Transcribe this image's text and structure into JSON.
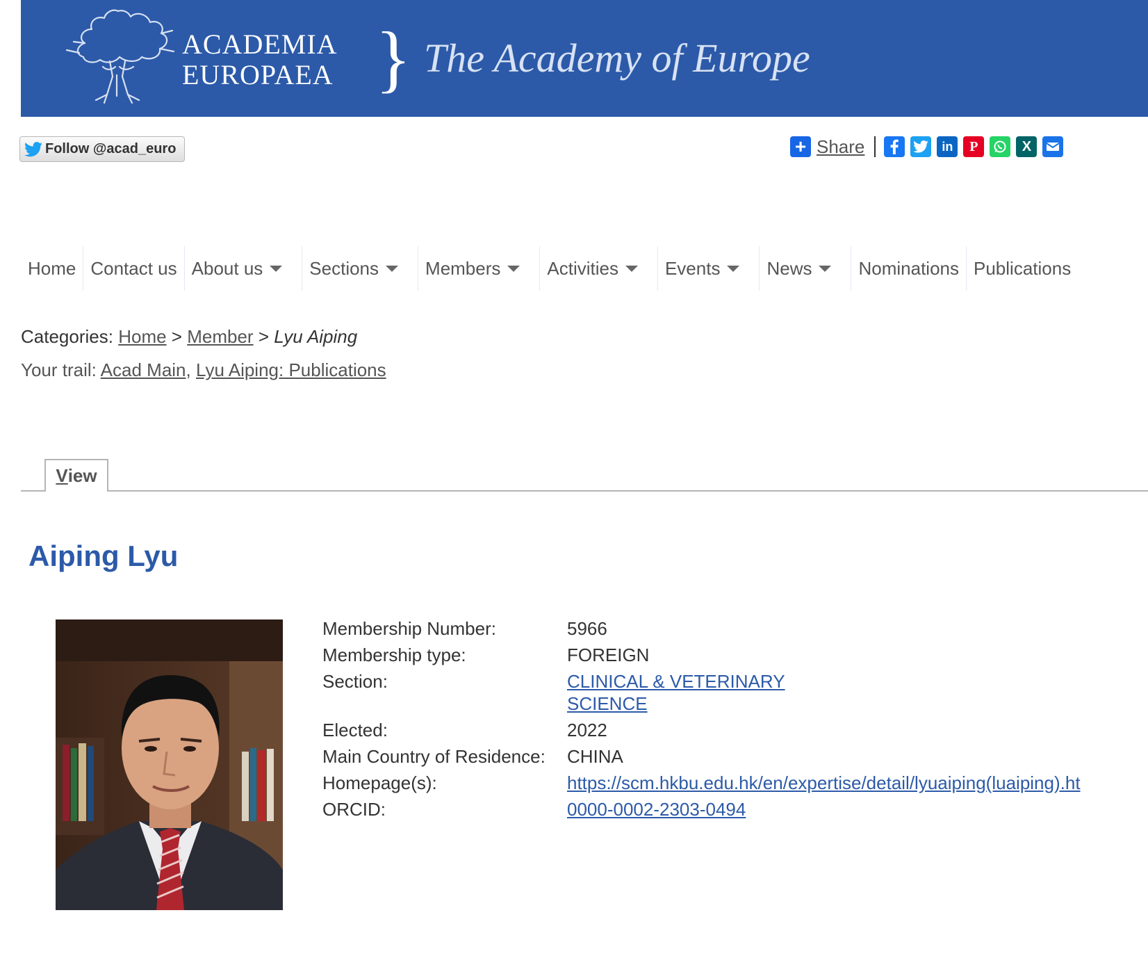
{
  "banner": {
    "logo_line1": "ACADEMIA",
    "logo_line2": "EUROPAEA",
    "brace": "}",
    "tagline": "The Academy of Europe",
    "bg_color": "#2c5aa9"
  },
  "follow": {
    "label": "Follow @acad_euro",
    "icon": "twitter-bird-icon"
  },
  "share": {
    "label": "Share",
    "icons": [
      {
        "name": "facebook-icon",
        "color": "#1877f2"
      },
      {
        "name": "twitter-icon",
        "color": "#1da1f2"
      },
      {
        "name": "linkedin-icon",
        "color": "#0a66c2"
      },
      {
        "name": "pinterest-icon",
        "color": "#e60023"
      },
      {
        "name": "whatsapp-icon",
        "color": "#25d366"
      },
      {
        "name": "xing-icon",
        "color": "#026466"
      },
      {
        "name": "email-icon",
        "color": "#1a73e8"
      }
    ]
  },
  "nav": {
    "home": "Home",
    "contact": "Contact us",
    "about": "About us",
    "sections": "Sections",
    "members": "Members",
    "activities": "Activities",
    "events": "Events",
    "news": "News",
    "nominations": "Nominations",
    "publications": "Publications"
  },
  "breadcrumb": {
    "prefix": "Categories:",
    "home": "Home",
    "sep": ">",
    "member": "Member",
    "current": "Lyu Aiping"
  },
  "trail": {
    "prefix": "Your trail:",
    "item1": "Acad Main",
    "comma": ",",
    "item2": "Lyu Aiping: Publications"
  },
  "tabs": {
    "view_first": "V",
    "view_rest": "iew"
  },
  "member": {
    "name": "Aiping Lyu",
    "fields": {
      "number_label": "Membership Number:",
      "number": "5966",
      "type_label": "Membership type:",
      "type": "FOREIGN",
      "section_label": "Section:",
      "section": "CLINICAL & VETERINARY SCIENCE",
      "elected_label": "Elected:",
      "elected": "2022",
      "country_label": "Main Country of Residence:",
      "country": "CHINA",
      "homepage_label": "Homepage(s):",
      "homepage": "https://scm.hkbu.edu.hk/en/expertise/detail/lyuaiping(luaiping).ht",
      "orcid_label": "ORCID:",
      "orcid": "0000-0002-2303-0494"
    }
  }
}
